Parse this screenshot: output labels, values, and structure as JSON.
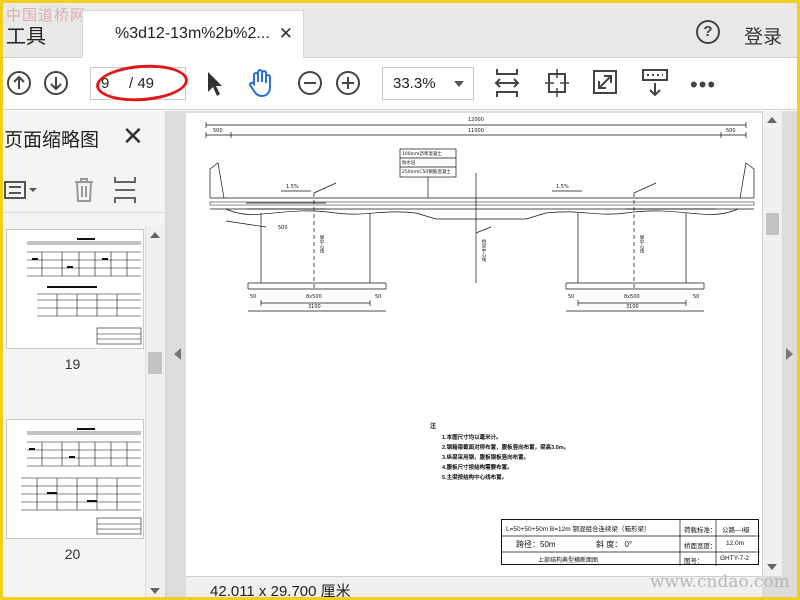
{
  "watermark_top": "中国道桥网",
  "watermark_site": "www.cndao.com",
  "header": {
    "tools_label": "工具",
    "tab_title": "%3d12-13m%2b%2...",
    "help_label": "?",
    "login_label": "登录"
  },
  "toolbar": {
    "current_page": "9",
    "total_pages": "/ 49",
    "zoom_level": "33.3%",
    "more_label": "•••"
  },
  "left_panel": {
    "title": "页面缩略图",
    "thumbnails": [
      {
        "page": "19"
      },
      {
        "page": "20"
      }
    ]
  },
  "status": {
    "dimensions": "42.011 x 29.700 厘米"
  },
  "drawing": {
    "dim_total": "12000",
    "dim_mid": "11000",
    "dim_left": "500",
    "dim_right": "500",
    "layer1": "100mm沥青混凝土",
    "layer2": "防水层",
    "layer3": "250mmC50钢筋混凝土",
    "slope_left": "1.5%",
    "slope_right": "1.5%",
    "label_500": "500",
    "pier_left": "8x500",
    "pier_right": "8x500",
    "base_left": "3100",
    "base_right": "3100",
    "base_50a": "50",
    "base_50b": "50",
    "base_50c": "50",
    "base_50d": "50",
    "center_left": "墩中心线",
    "center_mid": "桥梁中心线",
    "center_right": "墩中心线"
  },
  "notes": {
    "heading": "注",
    "lines": [
      "1.本图尺寸均以毫米计。",
      "2.钢箱梁截面对称布置，腹板竖向布置，梁高3.0m。",
      "3.纵梁采用钢，腹板钢板竖向布置。",
      "4.腹板尺寸按结构需要布置。",
      "5.主梁按结构中心线布置。"
    ]
  },
  "title_block": {
    "project": "L=50+50+50m B=12m 钢混组合连续梁（箱形梁）",
    "span": "跨径：50m",
    "skew": "斜  度：  0°",
    "section_title": "上部结构典型横断面图",
    "load_label": "荷载标准：",
    "load_value": "公路—I级",
    "width_label": "桥面宽度：",
    "width_value": "12.0m",
    "drawing_label": "图号：",
    "drawing_no": "GHTY-7-2"
  },
  "colors": {
    "frame_border": "#f2ce1d",
    "annotation_red": "#e01818",
    "hand_icon_blue": "#2b6fd6"
  }
}
